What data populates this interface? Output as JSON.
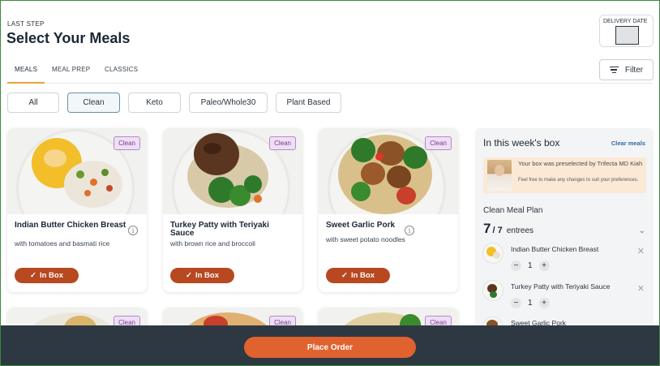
{
  "header": {
    "step_label": "LAST STEP",
    "title": "Select Your Meals",
    "delivery_label": "DELIVERY DATE"
  },
  "tabs": [
    {
      "label": "MEALS",
      "active": true
    },
    {
      "label": "MEAL PREP",
      "active": false
    },
    {
      "label": "CLASSICS",
      "active": false
    }
  ],
  "filter_button": {
    "label": "Filter",
    "icon": "filter-lines-icon"
  },
  "diet_filters": [
    {
      "label": "All",
      "active": false
    },
    {
      "label": "Clean",
      "active": true
    },
    {
      "label": "Keto",
      "active": false
    },
    {
      "label": "Paleo/Whole30",
      "active": false
    },
    {
      "label": "Plant Based",
      "active": false
    }
  ],
  "meals": [
    {
      "name": "Indian Butter Chicken Breast",
      "description": "with tomatoes and basmati rice",
      "tag": "Clean",
      "button": "In Box",
      "button_icon": "check-icon"
    },
    {
      "name": "Turkey Patty with Teriyaki Sauce",
      "description": "with brown rice and broccoli",
      "tag": "Clean",
      "button": "In Box",
      "button_icon": "check-icon"
    },
    {
      "name": "Sweet Garlic Pork",
      "description": "with sweet potato noodles",
      "tag": "Clean",
      "button": "In Box",
      "button_icon": "check-icon"
    }
  ],
  "lower_meals": [
    {
      "tag": "Clean"
    },
    {
      "tag": "Clean"
    },
    {
      "tag": "Clean"
    }
  ],
  "box_panel": {
    "title": "In this week's box",
    "clear_label": "Clear meals",
    "preselect_title": "Your box was preselected by Trifecta MD Kiah",
    "preselect_subtitle": "Feel free to make any changes to suit your preferences.",
    "plan_name": "Clean Meal Plan",
    "selected_count": "7",
    "total_count": "/ 7",
    "count_unit": "entrees",
    "items": [
      {
        "name": "Indian Butter Chicken Breast",
        "qty": "1"
      },
      {
        "name": "Turkey Patty with Teriyaki Sauce",
        "qty": "1"
      },
      {
        "name": "Sweet Garlic Pork",
        "qty": ""
      }
    ]
  },
  "footer": {
    "place_order": "Place Order"
  },
  "colors": {
    "accent_button": "#b7481f",
    "place_order": "#e0622f",
    "tab_underline": "#e6a33a",
    "clean_tag": "#eedff5",
    "bottom_bar": "#2e3842"
  }
}
